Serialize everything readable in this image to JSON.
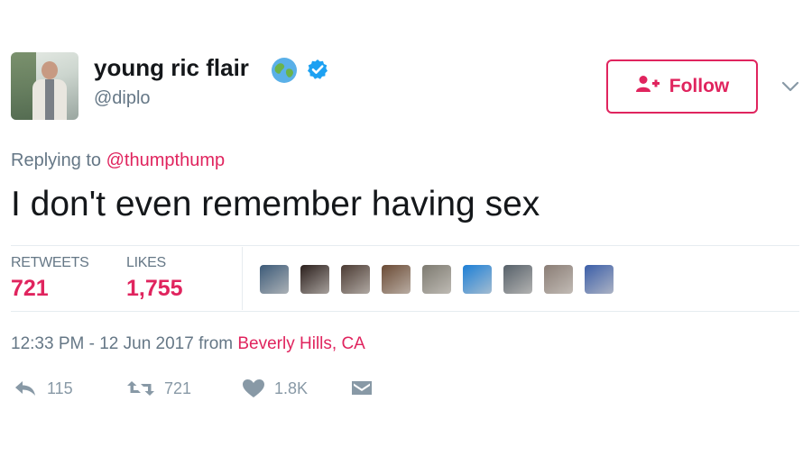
{
  "author": {
    "name": "young ric flair",
    "handle": "@diplo",
    "badge_emoji_icon": "globe-earth-icon",
    "verified_icon": "verified-badge-icon"
  },
  "follow_button": {
    "label": "Follow",
    "icon": "follow-user-icon"
  },
  "menu_icon": "chevron-down-icon",
  "tweet": {
    "reply_prefix": "Replying to",
    "reply_mention": "@thumpthump",
    "text": "I don't even remember having sex"
  },
  "stats": {
    "retweets_label": "RETWEETS",
    "retweets_value": "721",
    "likes_label": "LIKES",
    "likes_value": "1,755"
  },
  "liker_avatars": [
    {
      "name": "liker-avatar-1",
      "color": "#3c5a78"
    },
    {
      "name": "liker-avatar-2",
      "color": "#2b1f1c"
    },
    {
      "name": "liker-avatar-3",
      "color": "#4b3b33"
    },
    {
      "name": "liker-avatar-4",
      "color": "#6a4a34"
    },
    {
      "name": "liker-avatar-5",
      "color": "#7d7a70"
    },
    {
      "name": "liker-avatar-6",
      "color": "#1d7fd6"
    },
    {
      "name": "liker-avatar-7",
      "color": "#566069"
    },
    {
      "name": "liker-avatar-8",
      "color": "#8a7d75"
    },
    {
      "name": "liker-avatar-9",
      "color": "#3b5ea8"
    }
  ],
  "timestamp": {
    "time": "12:33 PM - 12 Jun 2017",
    "from_word": "from",
    "location": "Beverly Hills, CA"
  },
  "actions": {
    "reply_count": "115",
    "retweet_count": "721",
    "like_count": "1.8K"
  },
  "colors": {
    "accent": "#e0245e",
    "muted": "#657786",
    "verified": "#1da1f2",
    "icon_gray": "#8899a6"
  }
}
